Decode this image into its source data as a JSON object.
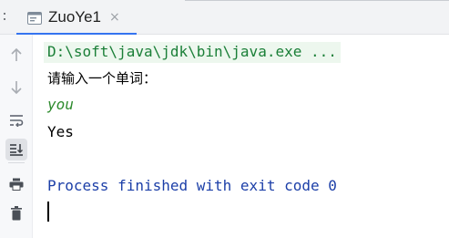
{
  "tab": {
    "label": "ZuoYe1",
    "close_glyph": "×",
    "icon": "console-icon"
  },
  "toolbar": {
    "icons": [
      "arrow-up-icon",
      "arrow-down-icon",
      "soft-wrap-icon",
      "scroll-to-end-icon",
      "print-icon",
      "trash-icon"
    ],
    "active": "scroll-to-end-icon"
  },
  "console": {
    "command_line": "D:\\soft\\java\\jdk\\bin\\java.exe ...",
    "prompt": "请输入一个单词：",
    "user_input": "you",
    "output": "Yes",
    "exit_message": "Process finished with exit code 0"
  },
  "colors": {
    "accent": "#3574f0",
    "command_text": "#1a7f37",
    "command_bg": "#edf7ee",
    "user_input": "#2e8b2e",
    "exit_text": "#1c3fa8"
  }
}
